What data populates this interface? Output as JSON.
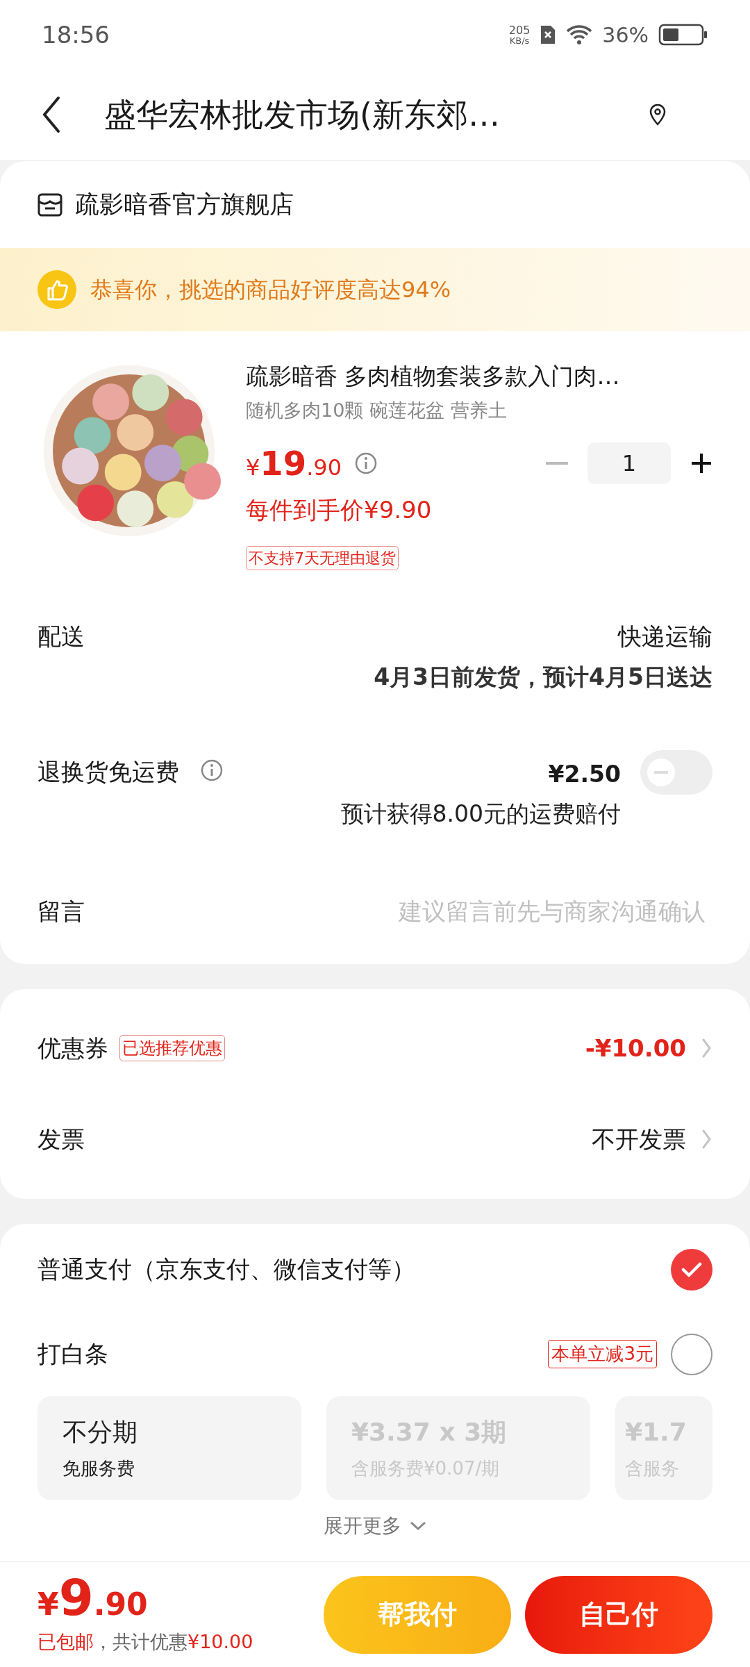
{
  "status_bar": {
    "time": "18:56",
    "speed_value": "205",
    "speed_unit": "KB/s",
    "battery": "36%"
  },
  "header": {
    "title": "盛华宏林批发市场(新东郊…"
  },
  "store": {
    "name": "疏影暗香官方旗舰店"
  },
  "banner": {
    "text": "恭喜你，挑选的商品好评度高达94%"
  },
  "product": {
    "title": "疏影暗香 多肉植物套装多款入门肉…",
    "spec": "随机多肉10颗 碗莲花盆 营养土",
    "currency": "¥",
    "price_int": "19",
    "price_dec": ".90",
    "final_price": "每件到手价¥9.90",
    "quantity": "1",
    "tag": "不支持7天无理由退货"
  },
  "delivery": {
    "label": "配送",
    "method": "快递运输",
    "eta": "4月3日前发货，预计4月5日送达"
  },
  "return_insurance": {
    "label": "退换货免运费",
    "price": "¥2.50",
    "note": "预计获得8.00元的运费赔付",
    "on": false
  },
  "message": {
    "label": "留言",
    "placeholder": "建议留言前先与商家沟通确认"
  },
  "coupon": {
    "label": "优惠券",
    "tag": "已选推荐优惠",
    "value": "-¥10.00"
  },
  "invoice": {
    "label": "发票",
    "value": "不开发票"
  },
  "payment_methods": [
    {
      "label": "普通支付（京东支付、微信支付等）",
      "selected": true
    },
    {
      "label": "打白条",
      "tag": "本单立减3元",
      "selected": false
    }
  ],
  "installments": [
    {
      "title": "不分期",
      "subtitle": "免服务费",
      "disabled": false
    },
    {
      "title": "¥3.37 x 3期",
      "subtitle": "含服务费¥0.07/期",
      "disabled": true
    },
    {
      "title": "¥1.7",
      "subtitle": "含服务",
      "disabled": true
    }
  ],
  "expand": {
    "label": "展开更多"
  },
  "footer": {
    "currency": "¥",
    "total_int": "9",
    "total_dec": ".90",
    "shipping": "已包邮",
    "discount_label": "，共计优惠",
    "discount_value": "¥10.00",
    "buttons": [
      {
        "label": "帮我付",
        "kind": "secondary"
      },
      {
        "label": "自己付",
        "kind": "primary"
      }
    ]
  }
}
